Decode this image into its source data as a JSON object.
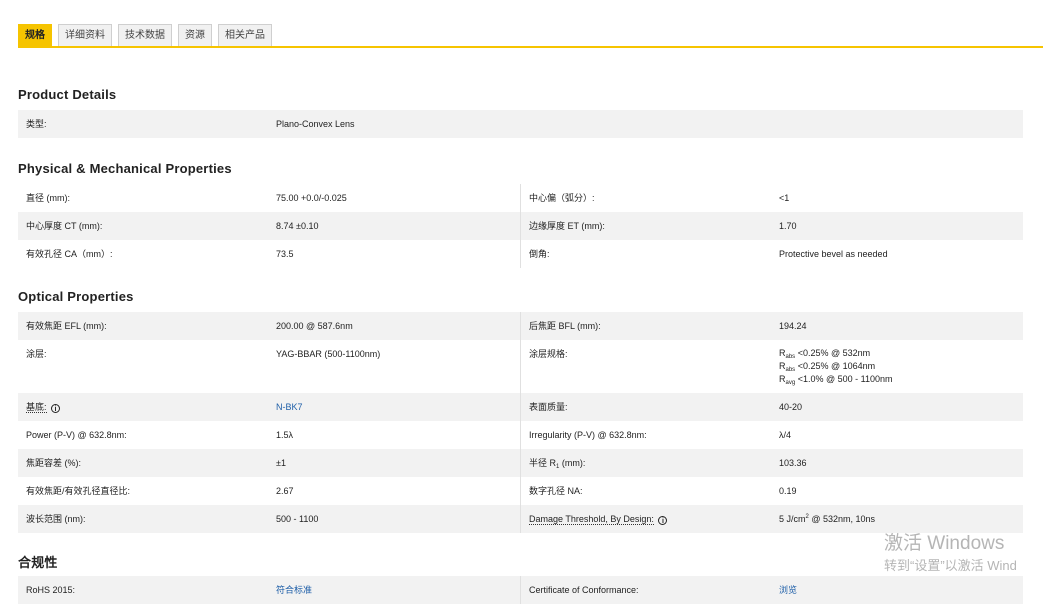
{
  "tabs": [
    "规格",
    "详细资料",
    "技术数据",
    "资源",
    "相关产品"
  ],
  "sections": {
    "product_details": {
      "title": "Product Details",
      "type_label": "类型:",
      "type_value": "Plano-Convex Lens"
    },
    "physical": {
      "title": "Physical & Mechanical Properties",
      "diameter_label": "直径 (mm):",
      "diameter_value": "75.00 +0.0/-0.025",
      "centering_label": "中心偏（弧分）:",
      "centering_value": "<1",
      "ct_label": "中心厚度 CT (mm):",
      "ct_value": "8.74 ±0.10",
      "et_label": "边缘厚度 ET (mm):",
      "et_value": "1.70",
      "ca_label": "有效孔径 CA（mm）:",
      "ca_value": "73.5",
      "bevel_label": "倒角:",
      "bevel_value": "Protective bevel as needed"
    },
    "optical": {
      "title": "Optical Properties",
      "efl_label": "有效焦距 EFL (mm):",
      "efl_value": "200.00 @ 587.6nm",
      "bfl_label": "后焦距 BFL (mm):",
      "bfl_value": "194.24",
      "coating_label": "涂层:",
      "coating_value": "YAG-BBAR (500-1100nm)",
      "coating_spec_label": "涂层规格:",
      "coating_spec": {
        "r1_sym": "R",
        "r1_sub": "abs",
        "r1_val": "<0.25% @ 532nm",
        "r2_sym": "R",
        "r2_sub": "abs",
        "r2_val": "<0.25% @ 1064nm",
        "r3_sym": "R",
        "r3_sub": "avg",
        "r3_val": "<1.0% @ 500 - 1100nm"
      },
      "substrate_label": "基底:",
      "substrate_value": "N-BK7",
      "surface_label": "表面质量:",
      "surface_value": "40-20",
      "power_label": "Power (P-V) @ 632.8nm:",
      "power_value": "1.5λ",
      "irregularity_label": "Irregularity (P-V) @ 632.8nm:",
      "irregularity_value": "λ/4",
      "focal_tol_label": "焦距容差 (%):",
      "focal_tol_value": "±1",
      "radius_label_pre": "半径 R",
      "radius_label_sub": "1",
      "radius_label_post": " (mm):",
      "radius_value": "103.36",
      "fnum_label": "有效焦距/有效孔径直径比:",
      "fnum_value": "2.67",
      "na_label": "数字孔径 NA:",
      "na_value": "0.19",
      "wavelength_label": "波长范围 (nm):",
      "wavelength_value": "500 - 1100",
      "damage_label": "Damage Threshold, By Design:",
      "damage_value_pre": "5 J/cm",
      "damage_value_sup": "2",
      "damage_value_post": " @ 532nm, 10ns"
    },
    "compliance": {
      "title": "合规性",
      "rohs_label": "RoHS 2015:",
      "rohs_value": "符合标准",
      "coc_label": "Certificate of Conformance:",
      "coc_value": "浏览"
    }
  },
  "info_icon_glyph": "i",
  "watermark": {
    "line1": "激活 Windows",
    "line2": "转到“设置”以激活 Wind"
  },
  "colors": {
    "accent": "#f6c400",
    "link": "#1f5fa8",
    "row_shade": "#f2f2f2"
  }
}
